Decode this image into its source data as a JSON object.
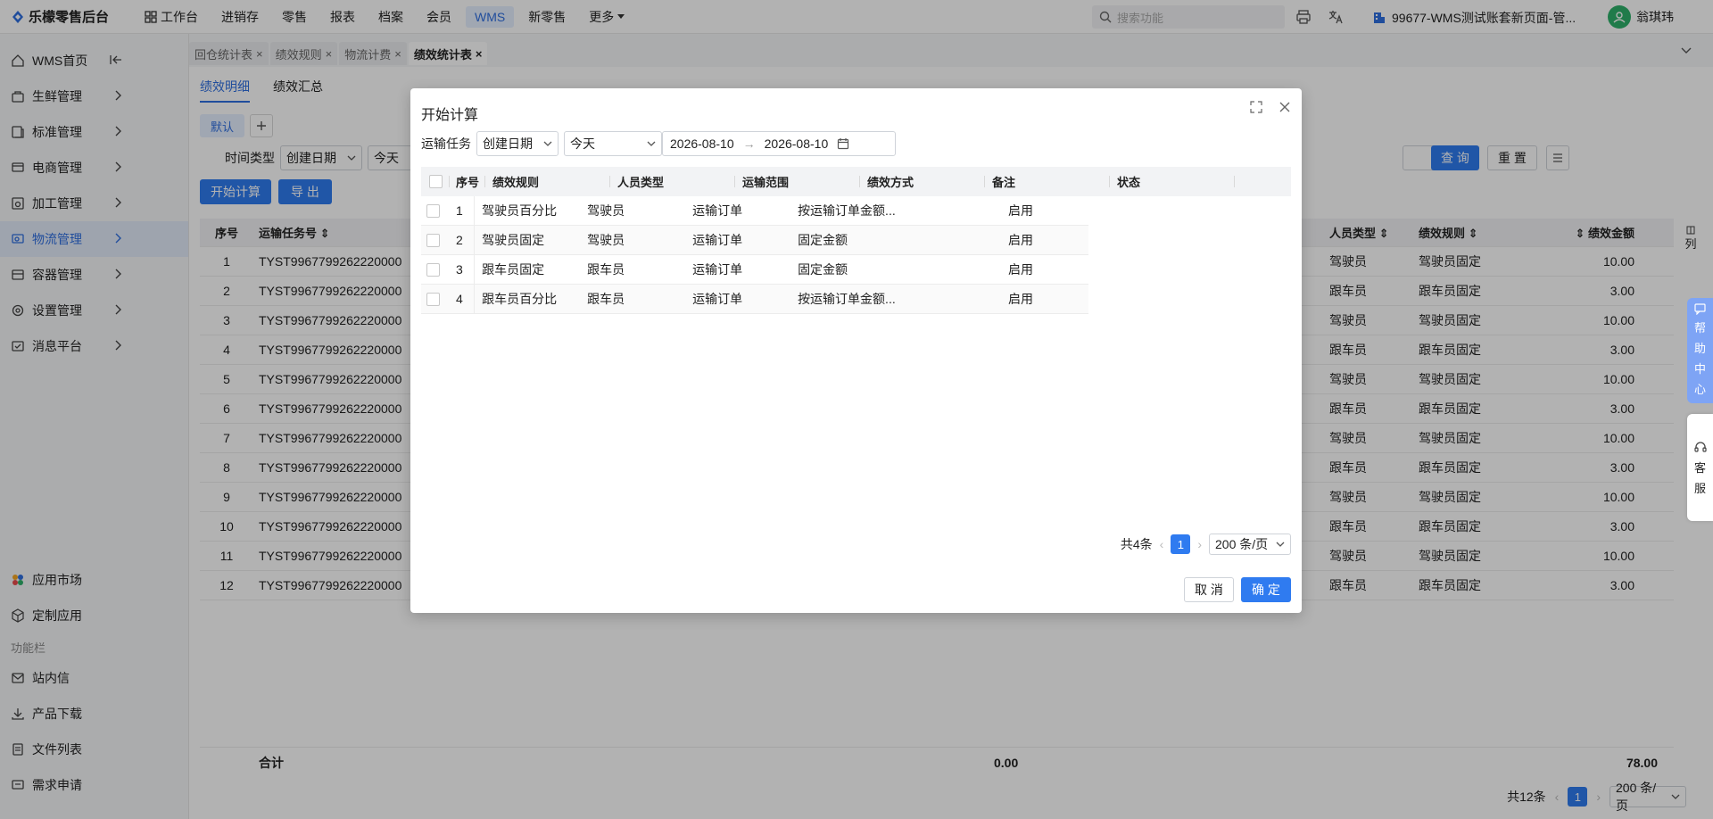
{
  "app": {
    "brand": "乐檬零售后台"
  },
  "topnav": [
    "工作台",
    "进销存",
    "零售",
    "报表",
    "档案",
    "会员",
    "WMS",
    "新零售",
    "更多"
  ],
  "search": {
    "placeholder": "搜索功能"
  },
  "tenant": "99677-WMS测试账套新页面-管...",
  "user": "翁琪玮",
  "sidebar": {
    "items": [
      "WMS首页",
      "生鲜管理",
      "标准管理",
      "电商管理",
      "加工管理",
      "物流管理",
      "容器管理",
      "设置管理",
      "消息平台"
    ],
    "bottom_items": [
      "应用市场",
      "定制应用"
    ],
    "section_label": "功能栏",
    "func_items": [
      "站内信",
      "产品下载",
      "文件列表",
      "需求申请"
    ]
  },
  "tabs": [
    "回仓统计表",
    "绩效规则",
    "物流计费",
    "绩效统计表"
  ],
  "page": {
    "subtabs": [
      "绩效明细",
      "绩效汇总"
    ],
    "view_default": "默认",
    "time_type_label": "时间类型",
    "time_type_value": "创建日期",
    "today_value": "今天",
    "query_button": "查 询",
    "reset_button": "重 置",
    "calc_button": "开始计算",
    "export_button": "导 出",
    "column_label": "列",
    "headers": [
      "序号",
      "运输任务号",
      "人员类型",
      "绩效规则",
      "绩效金额"
    ],
    "rows": [
      {
        "no": "1",
        "task": "TYST9967799262220000",
        "ptype": "驾驶员",
        "rule": "驾驶员固定",
        "amount": "10.00"
      },
      {
        "no": "2",
        "task": "TYST9967799262220000",
        "ptype": "跟车员",
        "rule": "跟车员固定",
        "amount": "3.00"
      },
      {
        "no": "3",
        "task": "TYST9967799262220000",
        "ptype": "驾驶员",
        "rule": "驾驶员固定",
        "amount": "10.00"
      },
      {
        "no": "4",
        "task": "TYST9967799262220000",
        "ptype": "跟车员",
        "rule": "跟车员固定",
        "amount": "3.00"
      },
      {
        "no": "5",
        "task": "TYST9967799262220000",
        "ptype": "驾驶员",
        "rule": "驾驶员固定",
        "amount": "10.00"
      },
      {
        "no": "6",
        "task": "TYST9967799262220000",
        "ptype": "跟车员",
        "rule": "跟车员固定",
        "amount": "3.00"
      },
      {
        "no": "7",
        "task": "TYST9967799262220000",
        "ptype": "驾驶员",
        "rule": "驾驶员固定",
        "amount": "10.00"
      },
      {
        "no": "8",
        "task": "TYST9967799262220000",
        "ptype": "跟车员",
        "rule": "跟车员固定",
        "amount": "3.00"
      },
      {
        "no": "9",
        "task": "TYST9967799262220000",
        "ptype": "驾驶员",
        "rule": "驾驶员固定",
        "amount": "10.00"
      },
      {
        "no": "10",
        "task": "TYST9967799262220000",
        "ptype": "跟车员",
        "rule": "跟车员固定",
        "amount": "3.00"
      },
      {
        "no": "11",
        "task": "TYST9967799262220000",
        "ptype": "驾驶员",
        "rule": "驾驶员固定",
        "amount": "10.00"
      },
      {
        "no": "12",
        "task": "TYST9967799262220000",
        "ptype": "跟车员",
        "rule": "跟车员固定",
        "amount": "3.00"
      }
    ],
    "total_label": "合计",
    "total_mid": "0.00",
    "total_amount": "78.00",
    "pager_total": "共12条",
    "pager_page": "1",
    "pager_size": "200 条/页"
  },
  "modal": {
    "title": "开始计算",
    "filter_label": "运输任务",
    "date_type": "创建日期",
    "range": "今天",
    "date_start": "2026-08-10",
    "date_sep": "→",
    "date_end": "2026-08-10",
    "headers": [
      "序号",
      "绩效规则",
      "人员类型",
      "运输范围",
      "绩效方式",
      "备注",
      "状态"
    ],
    "rows": [
      {
        "no": "1",
        "rule": "驾驶员百分比",
        "ptype": "驾驶员",
        "scope": "运输订单",
        "method": "按运输订单金额...",
        "note": "",
        "status": "启用"
      },
      {
        "no": "2",
        "rule": "驾驶员固定",
        "ptype": "驾驶员",
        "scope": "运输订单",
        "method": "固定金额",
        "note": "",
        "status": "启用"
      },
      {
        "no": "3",
        "rule": "跟车员固定",
        "ptype": "跟车员",
        "scope": "运输订单",
        "method": "固定金额",
        "note": "",
        "status": "启用"
      },
      {
        "no": "4",
        "rule": "跟车员百分比",
        "ptype": "跟车员",
        "scope": "运输订单",
        "method": "按运输订单金额...",
        "note": "",
        "status": "启用"
      }
    ],
    "pager_total": "共4条",
    "pager_page": "1",
    "pager_size": "200 条/页",
    "cancel": "取 消",
    "ok": "确 定"
  },
  "float": {
    "help": [
      "帮",
      "助",
      "中",
      "心"
    ],
    "cs": [
      "客",
      "服"
    ]
  },
  "colors": {
    "primary": "#2f7bf0",
    "active_nav_bg": "#e6efff",
    "avatar": "#2fb06a"
  }
}
